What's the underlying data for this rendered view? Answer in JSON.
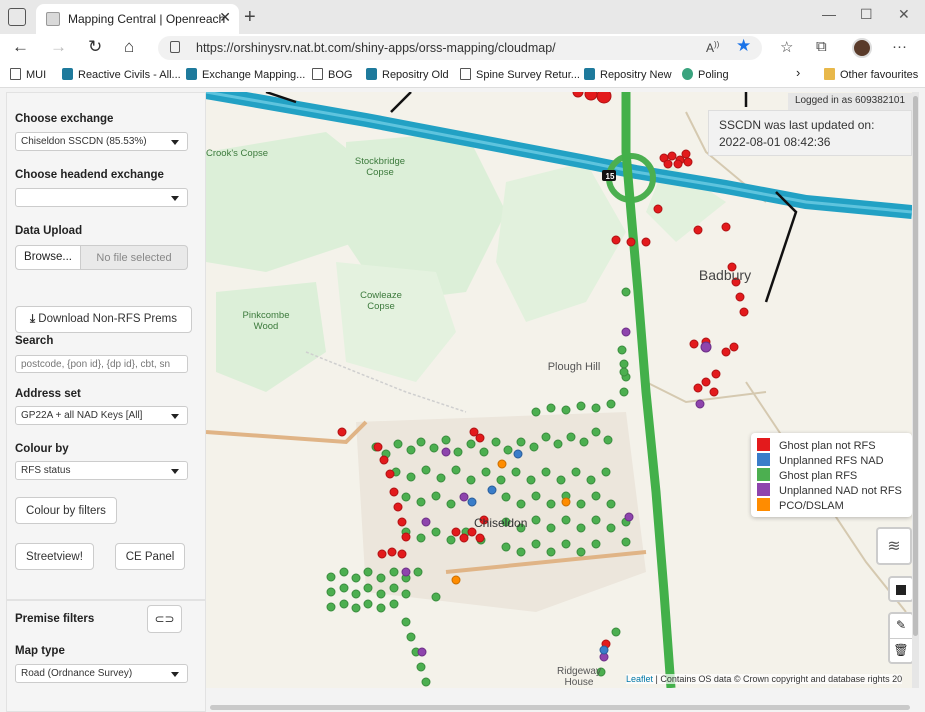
{
  "browser": {
    "tab_title": "Mapping Central | Openreach",
    "url": "https://orshinysrv.nat.bt.com/shiny-apps/orss-mapping/cloudmap/",
    "read_aloud": "A",
    "favourites": [
      {
        "label": "MUI",
        "icon": "page-icon"
      },
      {
        "label": "Reactive Civils - All...",
        "icon": "sharepoint-icon"
      },
      {
        "label": "Exchange Mapping...",
        "icon": "sharepoint-icon"
      },
      {
        "label": "BOG",
        "icon": "page-icon"
      },
      {
        "label": "Repositry Old",
        "icon": "sharepoint-icon"
      },
      {
        "label": "Spine Survey Retur...",
        "icon": "page-icon"
      },
      {
        "label": "Repositry New",
        "icon": "sharepoint-icon"
      },
      {
        "label": "Poling",
        "icon": "app-icon"
      }
    ],
    "other_favourites": "Other favourites"
  },
  "sidebar": {
    "choose_exchange_label": "Choose exchange",
    "choose_exchange_value": "Chiseldon SSCDN (85.53%)",
    "headend_label": "Choose headend exchange",
    "headend_value": "",
    "data_upload_label": "Data Upload",
    "browse_label": "Browse...",
    "no_file": "No file selected",
    "download_label": "Download Non-RFS Prems",
    "search_label": "Search",
    "search_placeholder": "postcode, {pon id}, {dp id}, cbt, sn",
    "address_set_label": "Address set",
    "address_set_value": "GP22A + all NAD Keys [All]",
    "colour_by_label": "Colour by",
    "colour_by_value": "RFS status",
    "colour_filters_button": "Colour by filters",
    "streetview_button": "Streetview!",
    "ce_panel_button": "CE Panel",
    "premise_filters_label": "Premise filters",
    "map_type_label": "Map type",
    "map_type_value": "Road (Ordnance Survey)"
  },
  "map": {
    "login_text": "Logged in as 609382101",
    "updated_line1": "SSCDN was last updated on:",
    "updated_line2": "2022-08-01 08:42:36",
    "labels": {
      "crooks_copse": "Crook's Copse",
      "stockbridge": "Stockbridge Copse",
      "cowleaze": "Cowleaze Copse",
      "pinkcombe": "Pinkcombe Wood",
      "plough_hill": "Plough Hill",
      "badbury": "Badbury",
      "ridgeway": "Ridgeway House",
      "junction": "15",
      "chiseldon": "Chiseldon"
    },
    "attribution_leaflet": "Leaflet",
    "attribution_rest": " | Contains OS data © Crown copyright and database rights 20"
  },
  "legend": [
    {
      "label": "Ghost plan not RFS",
      "color": "#e31a1c"
    },
    {
      "label": "Unplanned RFS NAD",
      "color": "#3a7dc9"
    },
    {
      "label": "Ghost plan RFS",
      "color": "#4caf50"
    },
    {
      "label": "Unplanned NAD not RFS",
      "color": "#8e44ad"
    },
    {
      "label": "PCO/DSLAM",
      "color": "#ff8c00"
    }
  ]
}
